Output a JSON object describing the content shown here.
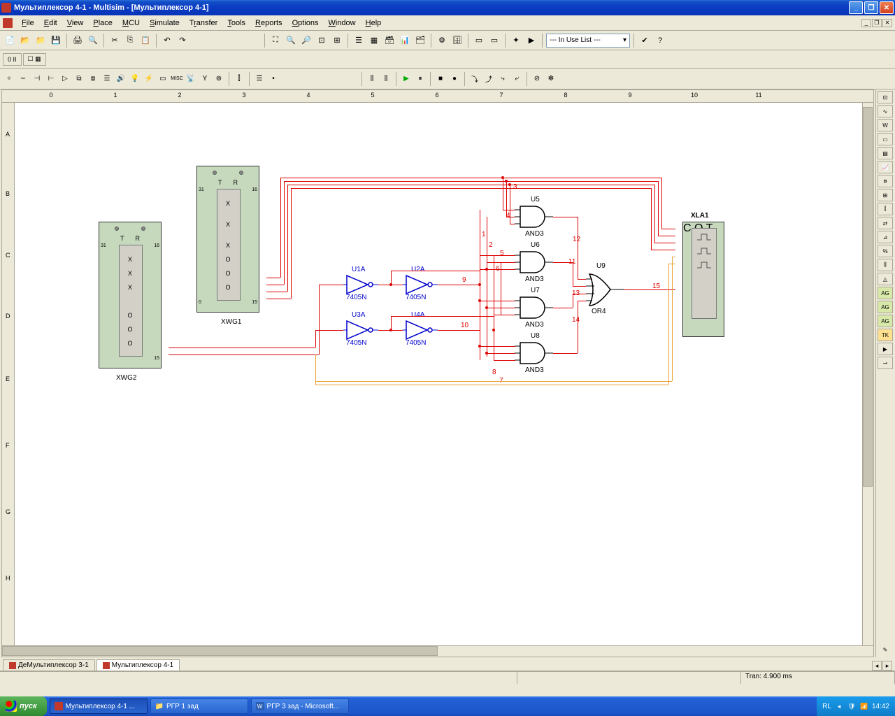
{
  "title": "Мультиплексор 4-1  - Multisim - [Мультиплексор 4-1]",
  "menu": {
    "file": "File",
    "edit": "Edit",
    "view": "View",
    "place": "Place",
    "mcu": "MCU",
    "simulate": "Simulate",
    "transfer": "Transfer",
    "tools": "Tools",
    "reports": "Reports",
    "options": "Options",
    "window": "Window",
    "help": "Help"
  },
  "dropdown": "--- In Use List ---",
  "viewbar": {
    "v1": "0 II",
    "v2": "☐ ▦"
  },
  "hruler": [
    "0",
    "1",
    "2",
    "3",
    "4",
    "5",
    "6",
    "7",
    "8",
    "9",
    "10",
    "11"
  ],
  "vruler": [
    "A",
    "B",
    "C",
    "D",
    "E",
    "F",
    "G",
    "H"
  ],
  "doctabs": {
    "t1": "ДеМультиплексор 3-1",
    "t2": "Мультиплексор 4-1"
  },
  "status": {
    "tran": "Tran: 4.900 ms"
  },
  "taskbar": {
    "start": "пуск",
    "t1": "Мультиплексор 4-1 ...",
    "t2": "РГР 1 зад",
    "t3": "РГР 3 зад - Microsoft...",
    "lang": "RL",
    "time": "14:42"
  },
  "schematic": {
    "xwg1": "XWG1",
    "xwg2": "XWG2",
    "xla1": "XLA1",
    "t": "T",
    "r": "R",
    "x": "X",
    "o": "O",
    "c": "C",
    "q": "Q",
    "u1a": "U1A",
    "u2a": "U2A",
    "u3a": "U3A",
    "u4a": "U4A",
    "u5": "U5",
    "u6": "U6",
    "u7": "U7",
    "u8": "U8",
    "u9": "U9",
    "p7405n": "7405N",
    "and3": "AND3",
    "or4": "OR4",
    "nets": {
      "n1": "1",
      "n2": "2",
      "n3": "3",
      "n4": "4",
      "n5": "5",
      "n6": "6",
      "n7": "7",
      "n8": "8",
      "n9": "9",
      "n10": "10",
      "n11": "11",
      "n12": "12",
      "n13": "13",
      "n14": "14",
      "n15": "15"
    },
    "pins": {
      "p15": "15",
      "p16": "16",
      "p31": "31",
      "p0": "0"
    }
  }
}
